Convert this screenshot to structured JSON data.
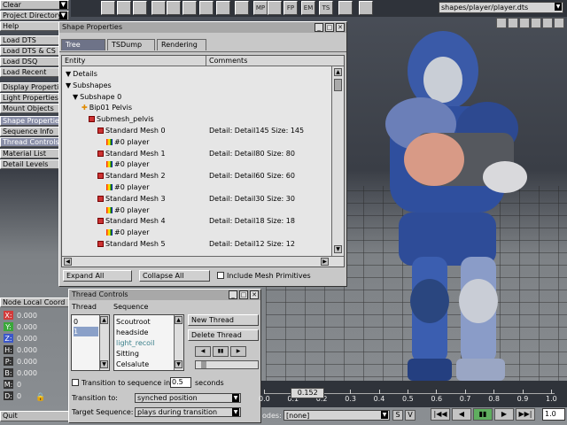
{
  "left_panel": {
    "clear": "Clear",
    "project_directory": "Project Directory",
    "help": "Help",
    "buttons": [
      "Load DTS",
      "Load DTS & CS",
      "Load DSQ",
      "Load Recent",
      "Display Properties",
      "Light Properties",
      "Mount Objects",
      "Shape Properties",
      "Sequence Info",
      "Thread Controls",
      "Material List",
      "Detail Levels"
    ],
    "node_local_coord": "Node Local Coord",
    "coords": [
      {
        "label": "X:",
        "value": "0.000",
        "color": "#d23b3b"
      },
      {
        "label": "Y:",
        "value": "0.000",
        "color": "#3aa83a"
      },
      {
        "label": "Z:",
        "value": "0.000",
        "color": "#3b57c9"
      },
      {
        "label": "H:",
        "value": "0.000",
        "color": "#333333"
      },
      {
        "label": "P:",
        "value": "0.000",
        "color": "#333333"
      },
      {
        "label": "B:",
        "value": "0.000",
        "color": "#333333"
      },
      {
        "label": "M:",
        "value": "0",
        "color": "#333333"
      },
      {
        "label": "D:",
        "value": "0",
        "color": "#333333"
      }
    ],
    "quit": "Quit"
  },
  "toolbar": {
    "icons": [
      "grid-icon",
      "camera-icon",
      "cube-icon",
      "light-icon",
      "paste-icon",
      "pan-icon",
      "move-icon",
      "zoom-icon",
      "select-icon",
      "mp-icon",
      "rotate-icon",
      "fp-icon",
      "em-icon",
      "ts-icon",
      "bones-icon",
      "pan-hand-icon"
    ],
    "labels": [
      "",
      "",
      "",
      "",
      "",
      "",
      "",
      "",
      "",
      "MP",
      "",
      "FP",
      "EM",
      "TS",
      "",
      ""
    ],
    "path": "shapes/player/player.dts"
  },
  "shape_properties": {
    "title": "Shape Properties",
    "tabs": [
      "Tree",
      "TSDump",
      "Rendering"
    ],
    "col_entity": "Entity",
    "col_comments": "Comments",
    "rows": [
      {
        "text": "Details",
        "comment": ""
      },
      {
        "text": "Subshapes",
        "comment": ""
      },
      {
        "text": "Subshape 0",
        "comment": ""
      },
      {
        "text": "Bip01 Pelvis",
        "comment": ""
      },
      {
        "text": "Submesh_pelvis",
        "comment": ""
      },
      {
        "text": "Standard Mesh 0",
        "comment": "Detail: Detail145 Size: 145"
      },
      {
        "text": "#0 player",
        "comment": ""
      },
      {
        "text": "Standard Mesh 1",
        "comment": "Detail: Detail80 Size: 80"
      },
      {
        "text": "#0 player",
        "comment": ""
      },
      {
        "text": "Standard Mesh 2",
        "comment": "Detail: Detail60 Size: 60"
      },
      {
        "text": "#0 player",
        "comment": ""
      },
      {
        "text": "Standard Mesh 3",
        "comment": "Detail: Detail30 Size: 30"
      },
      {
        "text": "#0 player",
        "comment": ""
      },
      {
        "text": "Standard Mesh 4",
        "comment": "Detail: Detail18 Size: 18"
      },
      {
        "text": "#0 player",
        "comment": ""
      },
      {
        "text": "Standard Mesh 5",
        "comment": "Detail: Detail12 Size: 12"
      }
    ],
    "expand_all": "Expand All",
    "collapse_all": "Collapse All",
    "include_mesh": "Include Mesh Primitives"
  },
  "thread_controls": {
    "title": "Thread Controls",
    "col_thread": "Thread",
    "col_sequence": "Sequence",
    "threads": [
      "0",
      "1"
    ],
    "sequences": [
      "Scoutroot",
      "headside",
      "light_recoil",
      "Sitting",
      "Celsalute"
    ],
    "selected_sequence": "light_recoil",
    "new_thread": "New Thread",
    "delete_thread": "Delete Thread",
    "transition_label": "Transition to sequence in",
    "transition_value": "0.5",
    "seconds": "seconds",
    "transition_to_label": "Transition to:",
    "transition_to_value": "synched position",
    "target_seq_label": "Target Sequence:",
    "target_seq_value": "plays during transition"
  },
  "timeline": {
    "ticks": [
      "0.0",
      "0.1",
      "0.2",
      "0.3",
      "0.4",
      "0.5",
      "0.6",
      "0.7",
      "0.8",
      "0.9",
      "1.0"
    ],
    "position_label": "0.152",
    "position_fraction": 0.152,
    "nodes_label": "odes:",
    "nodes_value": "[none]",
    "s": "S",
    "v": "V",
    "speed": "1.0"
  }
}
